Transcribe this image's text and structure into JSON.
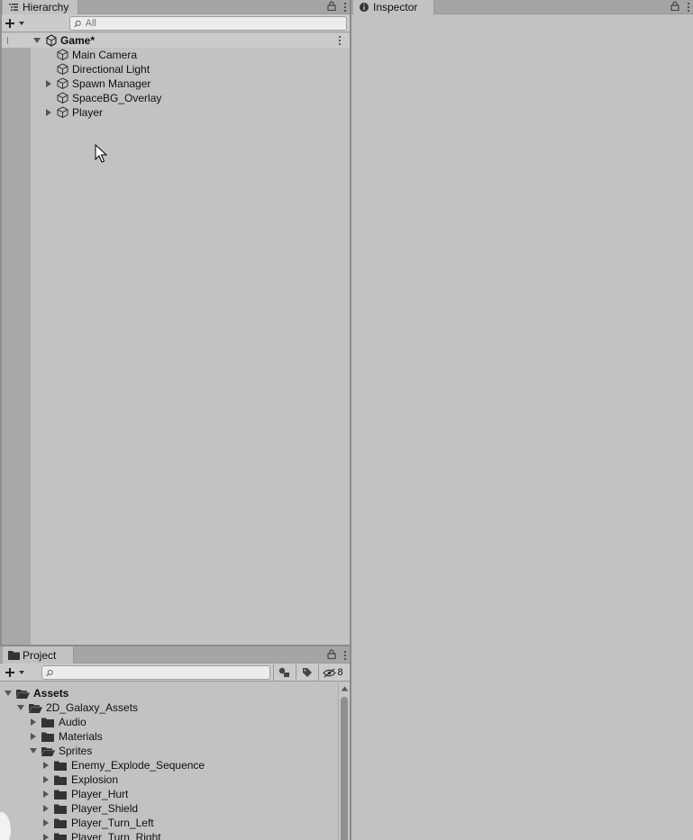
{
  "hierarchy": {
    "tab_label": "Hierarchy",
    "search_placeholder": "All",
    "scene_name": "Game*",
    "items": [
      {
        "label": "Main Camera",
        "expandable": false
      },
      {
        "label": "Directional Light",
        "expandable": false
      },
      {
        "label": "Spawn Manager",
        "expandable": true
      },
      {
        "label": "SpaceBG_Overlay",
        "expandable": false
      },
      {
        "label": "Player",
        "expandable": true
      }
    ]
  },
  "inspector": {
    "tab_label": "Inspector"
  },
  "project": {
    "tab_label": "Project",
    "search_placeholder": "",
    "hidden_count": "8",
    "tree": [
      {
        "label": "Assets",
        "depth": 0,
        "state": "expanded",
        "bold": true
      },
      {
        "label": "2D_Galaxy_Assets",
        "depth": 1,
        "state": "expanded"
      },
      {
        "label": "Audio",
        "depth": 2,
        "state": "collapsed"
      },
      {
        "label": "Materials",
        "depth": 2,
        "state": "collapsed"
      },
      {
        "label": "Sprites",
        "depth": 2,
        "state": "expanded"
      },
      {
        "label": "Enemy_Explode_Sequence",
        "depth": 3,
        "state": "collapsed"
      },
      {
        "label": "Explosion",
        "depth": 3,
        "state": "collapsed"
      },
      {
        "label": "Player_Hurt",
        "depth": 3,
        "state": "collapsed"
      },
      {
        "label": "Player_Shield",
        "depth": 3,
        "state": "collapsed"
      },
      {
        "label": "Player_Turn_Left",
        "depth": 3,
        "state": "collapsed"
      },
      {
        "label": "Player_Turn_Right",
        "depth": 3,
        "state": "collapsed"
      }
    ]
  },
  "colors": {
    "panel_bg": "#c2c2c2",
    "tabbar_bg": "#a5a5a5",
    "gutter_bg": "#a9a9a9",
    "scene_row_bg": "#cbcbcb"
  }
}
